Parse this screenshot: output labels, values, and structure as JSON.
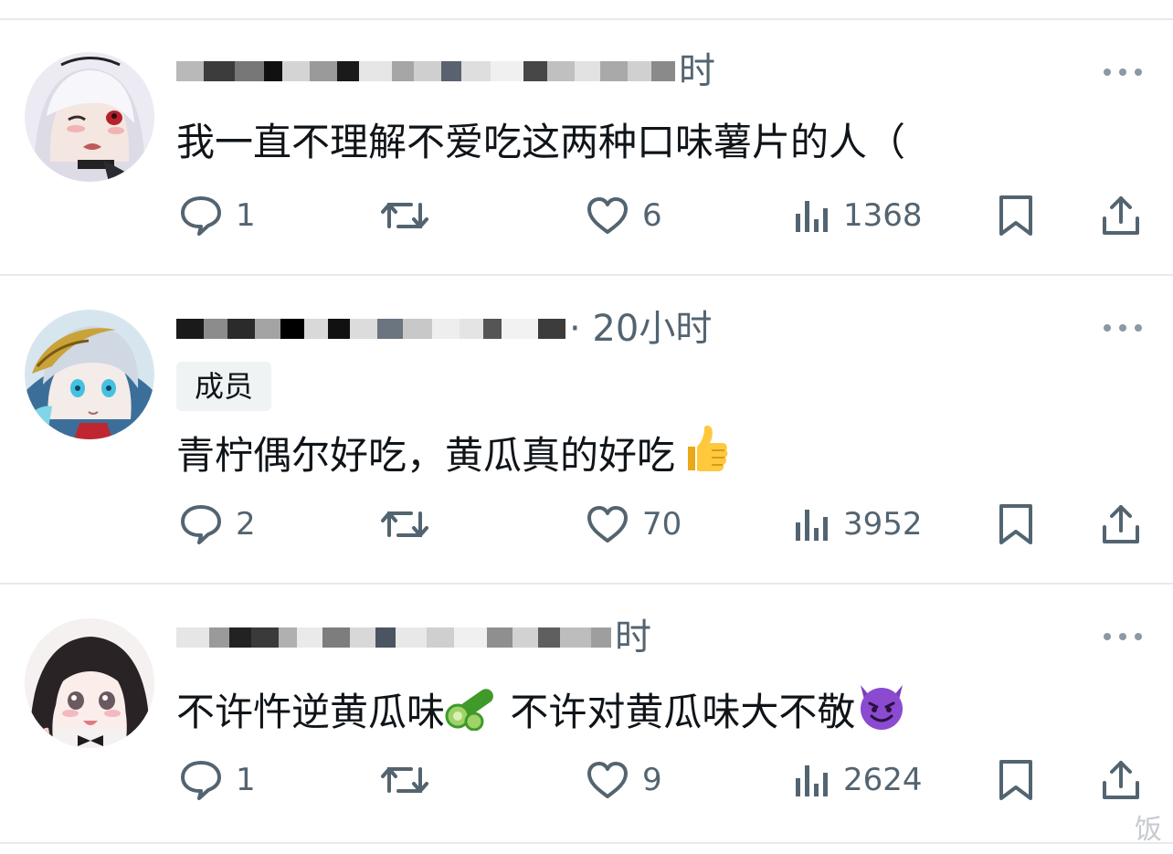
{
  "posts": [
    {
      "timestamp": "时",
      "badge": "",
      "text": "我一直不理解不爱吃这两种口味薯片的人（",
      "text_after_emoji": "",
      "emoji": [],
      "reply_count": "1",
      "like_count": "6",
      "view_count": "1368"
    },
    {
      "timestamp": "· 20小时",
      "badge": "成员",
      "text": "青柠偶尔好吃，黄瓜真的好吃",
      "text_after_emoji": "",
      "emoji": [
        "thumbs-up-emoji"
      ],
      "reply_count": "2",
      "like_count": "70",
      "view_count": "3952"
    },
    {
      "timestamp": "时",
      "badge": "",
      "text": "不许忤逆黄瓜味",
      "text_after_emoji": " 不许对黄瓜味大不敬",
      "emoji": [
        "cucumber-emoji",
        "smiling-devil-emoji"
      ],
      "reply_count": "1",
      "like_count": "9",
      "view_count": "2624"
    }
  ],
  "watermark": "饭",
  "colors": {
    "text": "#0f1419",
    "secondary": "#536471",
    "divider": "#e7e9eb",
    "badge_bg": "#eff3f4"
  },
  "icons": [
    "reply-icon",
    "retweet-icon",
    "like-icon",
    "views-icon",
    "bookmark-icon",
    "share-icon",
    "more-icon"
  ]
}
